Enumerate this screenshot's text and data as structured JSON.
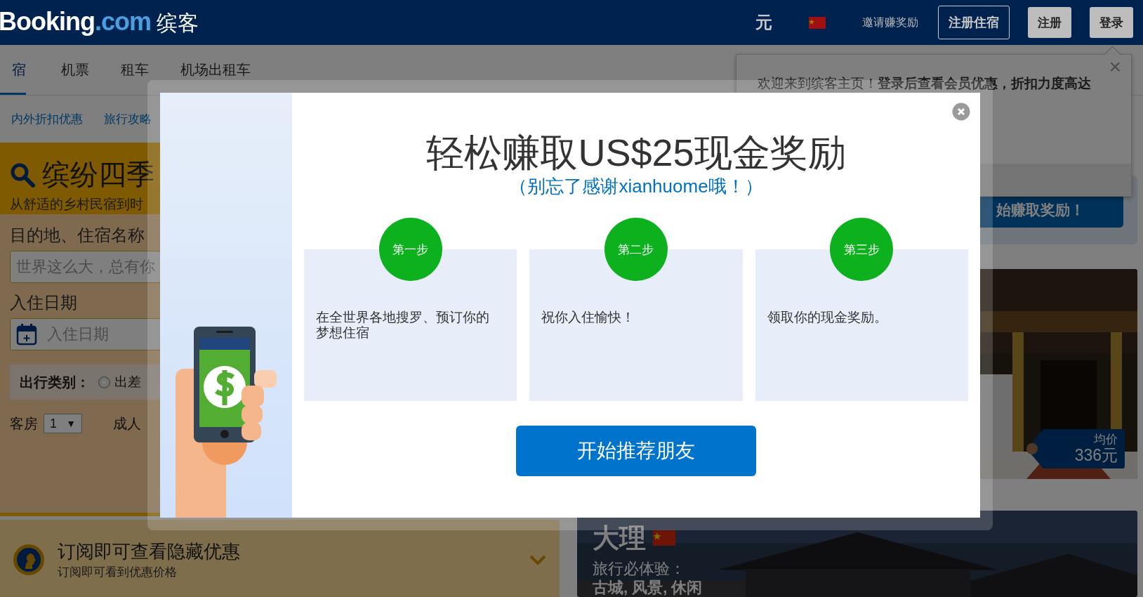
{
  "header": {
    "logo_brand": "Booking",
    "logo_domain": ".com",
    "logo_cn": "缤客",
    "currency": "元",
    "invite": "邀请赚奖励",
    "buttons": [
      {
        "label": "注册住宿",
        "kind": "outline"
      },
      {
        "label": "注册",
        "kind": "solid"
      },
      {
        "label": "登录",
        "kind": "solid"
      }
    ]
  },
  "nav": {
    "tabs": [
      {
        "label": "宿",
        "selected": true
      },
      {
        "label": "机票",
        "selected": false
      },
      {
        "label": "租车",
        "selected": false
      },
      {
        "label": "机场出租车",
        "selected": false
      }
    ],
    "links": [
      "内外折扣优惠",
      "旅行攻略"
    ]
  },
  "search": {
    "title": "缤纷四季",
    "subtitle": "从舒适的乡村民宿到时",
    "destination_label": "目的地、住宿名称",
    "destination_placeholder": "世界这么大，总有你",
    "checkin_label": "入住日期",
    "checkin_placeholder": "入住日期",
    "trip_type_label": "出行类别：",
    "trip_types": [
      {
        "label": "出差",
        "selected": false
      }
    ],
    "rooms_label": "客房",
    "rooms_value": "1",
    "rooms_caret": "▼",
    "adults_label": "成人"
  },
  "subscribe": {
    "title": "订阅即可查看隐藏优惠",
    "subtitle": "订阅即可看到优惠价格"
  },
  "welcome": {
    "text": "欢迎来到缤客主页！**登录后查看会员优惠，折扣力度高达**",
    "close": "×"
  },
  "reward_button": "始赚取奖励！",
  "deals": [
    {
      "kind": "temple",
      "avg_label": "均价",
      "price": "336元"
    },
    {
      "kind": "town",
      "city": "大理",
      "tagline": "旅行必体验：",
      "tags": "古城, 风景, 休闲"
    }
  ],
  "modal": {
    "title": "轻松赚取US$25现金奖励",
    "subtitle": "（别忘了感谢xianhuome哦！）",
    "steps": [
      {
        "badge": "第一步",
        "text": "在全世界各地搜罗、预订你的梦想住宿"
      },
      {
        "badge": "第二步",
        "text": "祝你入住愉快！"
      },
      {
        "badge": "第三步",
        "text": "领取你的现金奖励。"
      }
    ],
    "button": "开始推荐朋友"
  }
}
